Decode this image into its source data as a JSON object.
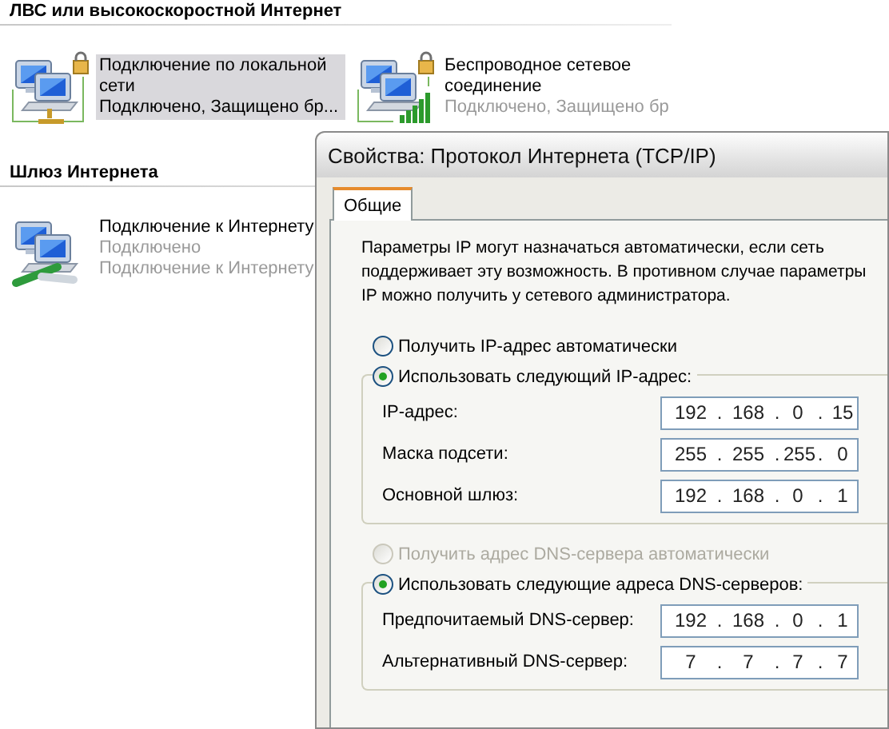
{
  "explorer": {
    "groups": [
      {
        "heading": "ЛВС или высокоскоростной Интернет",
        "items": [
          {
            "kind": "lan",
            "title": "Подключение по локальной сети",
            "lines": [
              "Подключено, Защищено бр..."
            ],
            "selected": true
          },
          {
            "kind": "wireless",
            "title": "Беспроводное сетевое соединение",
            "lines": [
              "Подключено, Защищено бр"
            ],
            "selected": false
          }
        ]
      },
      {
        "heading": "Шлюз Интернета",
        "items": [
          {
            "kind": "gateway",
            "title": "Подключение к Интернету",
            "lines": [
              "Подключено",
              "Подключение к Интернету"
            ],
            "selected": false
          }
        ]
      }
    ]
  },
  "dialog": {
    "title": "Свойства: Протокол Интернета (TCP/IP)",
    "tabs": [
      {
        "label": "Общие",
        "selected": true
      }
    ],
    "description": [
      "Параметры IP могут назначаться автоматически, если сеть",
      "поддерживает эту возможность. В противном случае параметры",
      "IP можно получить у сетевого администратора."
    ],
    "sections": [
      {
        "auto": {
          "label": "Получить IP-адрес автоматически",
          "selected": false,
          "disabled": false
        },
        "manual": {
          "label": "Использовать следующий IP-адрес:",
          "selected": true,
          "disabled": false
        },
        "fields": [
          {
            "label": "IP-адрес:",
            "parts": [
              "192",
              ".",
              "168",
              ".",
              "0",
              ".",
              "15"
            ]
          },
          {
            "label": "Маска подсети:",
            "parts": [
              "255",
              ".",
              "255",
              ".",
              "255",
              ".",
              "0"
            ]
          },
          {
            "label": "Основной шлюз:",
            "parts": [
              "192",
              ".",
              "168",
              ".",
              "0",
              ".",
              "1"
            ]
          }
        ]
      },
      {
        "auto": {
          "label": "Получить адрес DNS-сервера автоматически",
          "selected": false,
          "disabled": true
        },
        "manual": {
          "label": "Использовать следующие адреса DNS-серверов:",
          "selected": true,
          "disabled": false
        },
        "fields": [
          {
            "label": "Предпочитаемый DNS-сервер:",
            "parts": [
              "192",
              ".",
              "168",
              ".",
              "0",
              ".",
              "1"
            ]
          },
          {
            "label": "Альтернативный DNS-сервер:",
            "parts": [
              "7",
              ".",
              "7",
              ".",
              "7",
              ".",
              "7"
            ]
          }
        ]
      }
    ]
  }
}
